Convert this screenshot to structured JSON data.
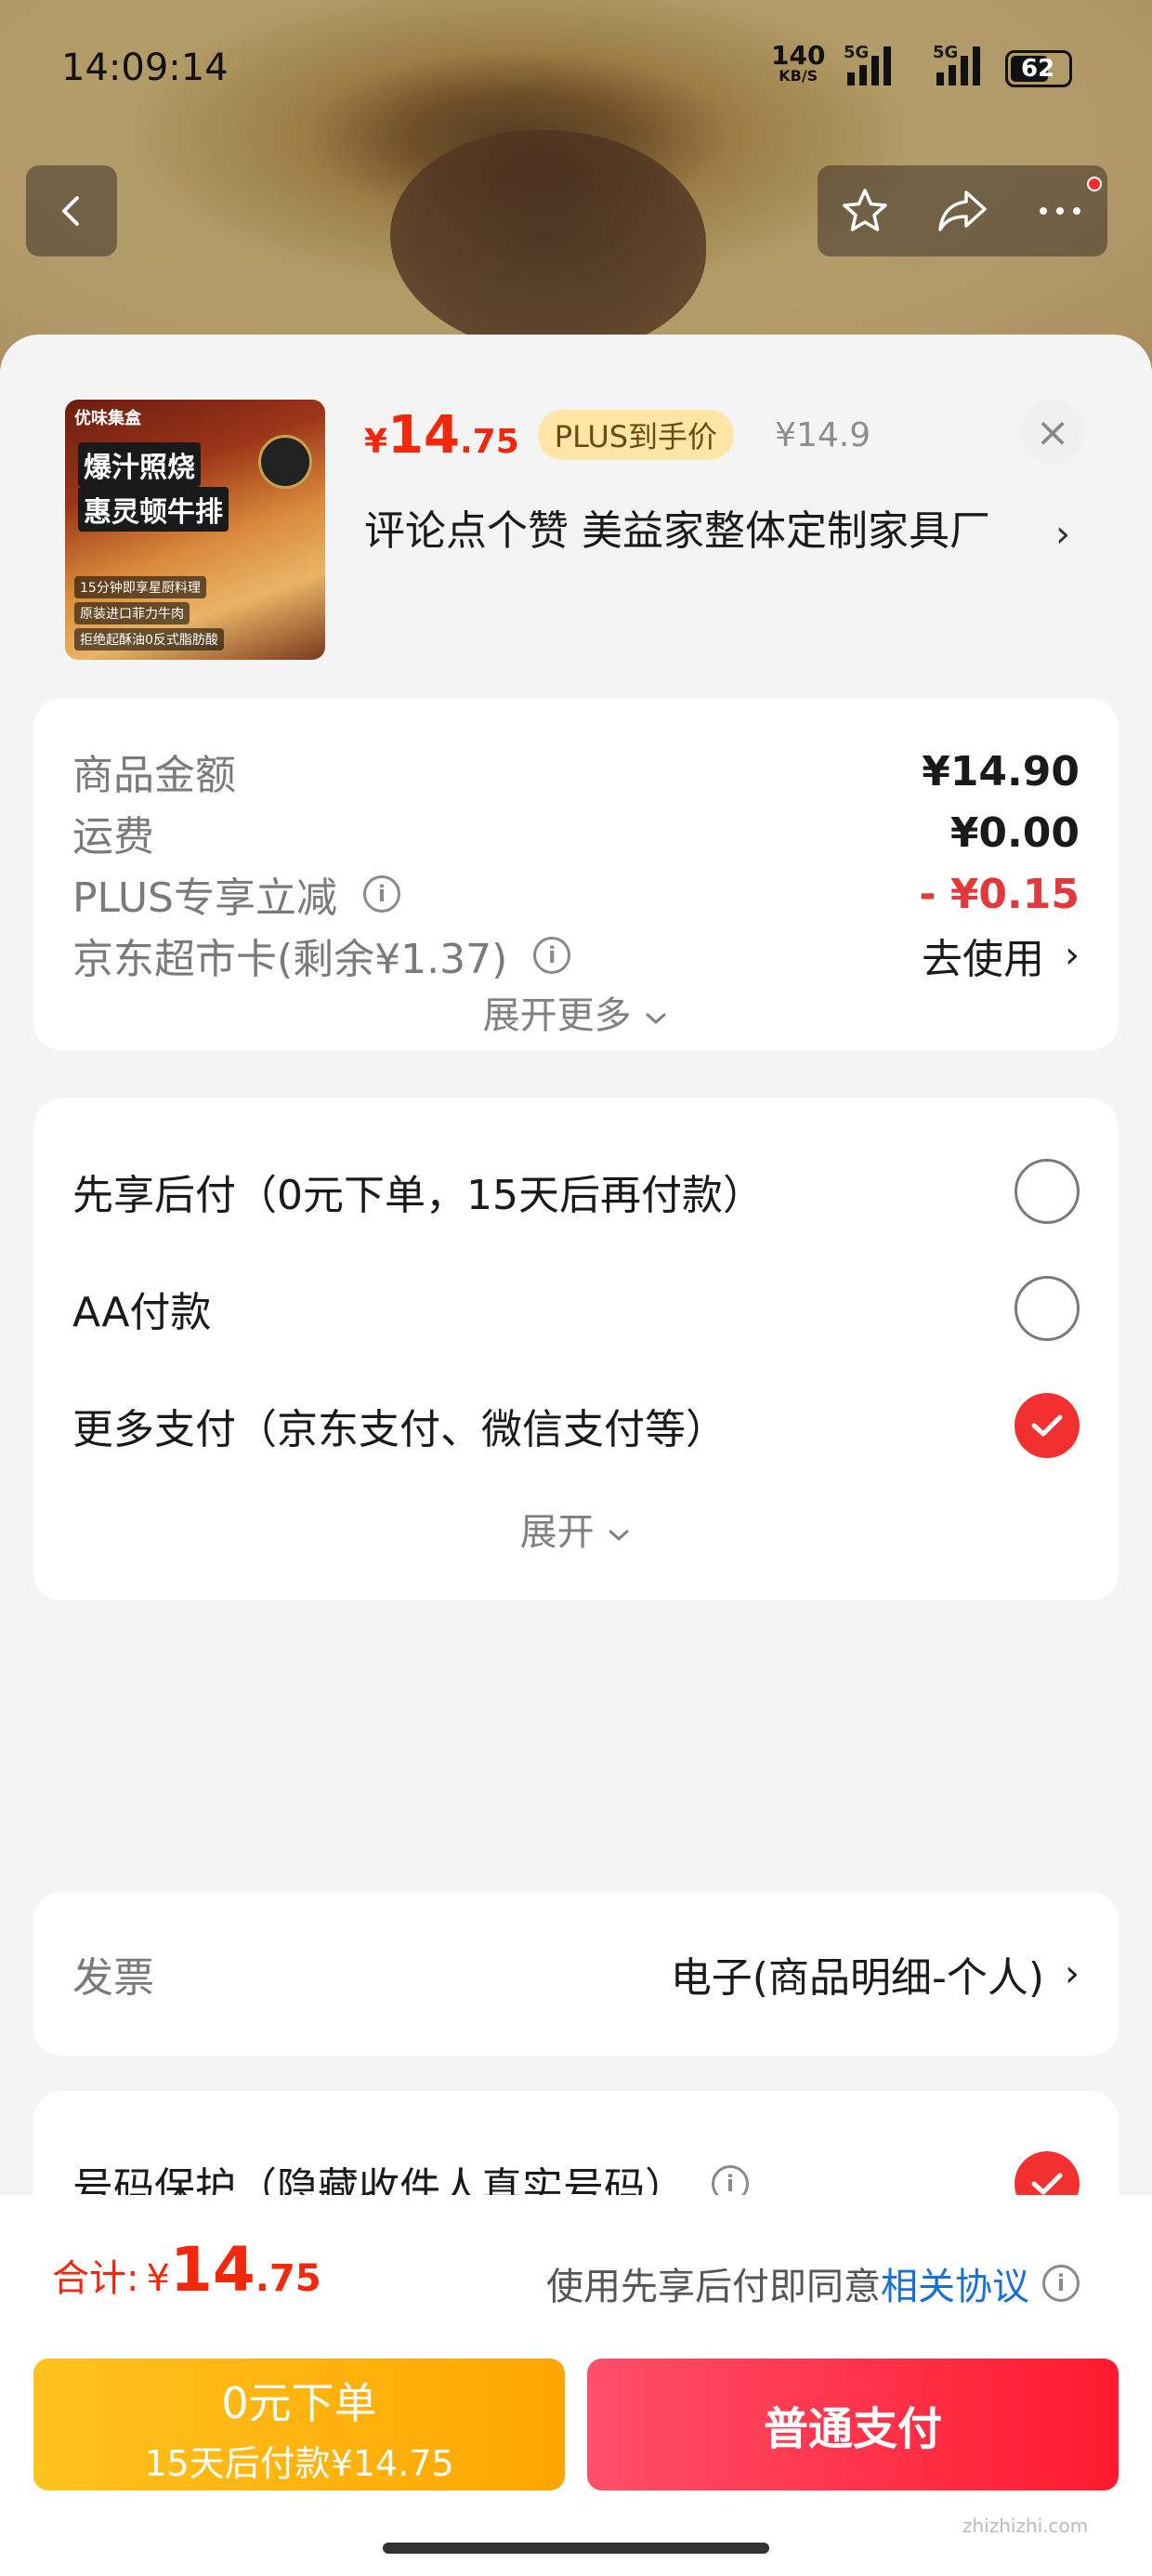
{
  "status": {
    "time": "14:09:14",
    "net_speed": "140",
    "net_unit": "KB/S",
    "sig1": "5G",
    "sig2": "5G",
    "battery": "62"
  },
  "product": {
    "thumb_brand": "优味集盒",
    "thumb_title1": "爆汁照烧",
    "thumb_title2": "惠灵顿牛排",
    "thumb_line1": "15分钟即享星厨料理",
    "thumb_line2": "原装进口菲力牛肉",
    "thumb_line3": "拒绝起酥油0反式脂肪酸",
    "price_currency": "¥",
    "price_int": "14",
    "price_dec": ".75",
    "plus_tag": "PLUS到手价",
    "orig_price": "¥14.9",
    "close_glyph": "×",
    "shop_name": "评论点个赞  美益家整体定制家具厂"
  },
  "fees": {
    "goods_label": "商品金额",
    "goods_value": "¥14.90",
    "ship_label": "运费",
    "ship_value": "¥0.00",
    "plus_label": "PLUS专享立减",
    "plus_value": "- ¥0.15",
    "card_label": "京东超市卡(剩余¥1.37)",
    "card_value": "去使用",
    "expand_more": "展开更多"
  },
  "payment": {
    "opt1": "先享后付（0元下单，15天后再付款）",
    "opt2": "AA付款",
    "opt3": "更多支付（京东支付、微信支付等）",
    "expand": "展开",
    "selected": "opt3"
  },
  "invoice": {
    "label": "发票",
    "value": "电子(商品明细-个人)"
  },
  "privacy": {
    "label": "号码保护（隐藏收件人真实号码）",
    "checked": true
  },
  "footer": {
    "total_label": "合计:",
    "total_currency": "¥",
    "total_int": "14",
    "total_dec": ".75",
    "agree_text": "使用先享后付即同意",
    "agree_link": "相关协议",
    "zero_btn_line1": "0元下单",
    "zero_btn_line2": "15天后付款¥14.75",
    "pay_btn": "普通支付",
    "watermark": "zhizhizhi.com"
  },
  "colors": {
    "accent_red": "#f2270c",
    "plus_gold": "#ffe6a6",
    "pay_red": "#ff1a2e",
    "zero_yellow": "#ffa600"
  },
  "icons": [
    "back-icon",
    "star-icon",
    "share-icon",
    "more-icon",
    "close-icon",
    "info-icon",
    "chevron-right-icon",
    "check-icon"
  ]
}
